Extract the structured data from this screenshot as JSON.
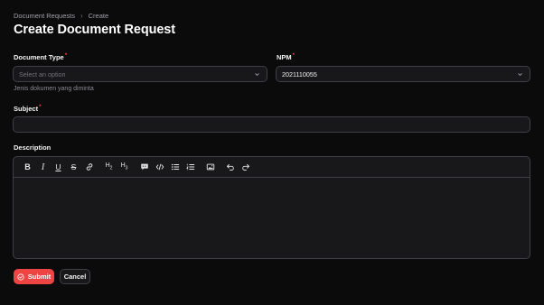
{
  "breadcrumb": {
    "parent": "Document Requests",
    "current": "Create"
  },
  "page": {
    "title": "Create Document Request"
  },
  "form": {
    "document_type": {
      "label": "Document Type",
      "required_mark": "*",
      "placeholder": "Select an option",
      "hint": "Jenis dokumen yang diminta"
    },
    "npm": {
      "label": "NPM",
      "required_mark": "*",
      "value": "2021110055"
    },
    "subject": {
      "label": "Subject",
      "required_mark": "*",
      "value": ""
    },
    "description": {
      "label": "Description",
      "toolbar": [
        {
          "name": "bold-button",
          "icon": "bold-icon",
          "glyph": "B"
        },
        {
          "name": "italic-button",
          "icon": "italic-icon",
          "glyph": "I"
        },
        {
          "name": "underline-button",
          "icon": "underline-icon",
          "glyph": "U"
        },
        {
          "name": "strikethrough-button",
          "icon": "strikethrough-icon",
          "glyph": "S"
        },
        {
          "name": "link-button",
          "icon": "link-icon"
        },
        {
          "name": "heading-2-button",
          "icon": "h2-icon",
          "glyph": "H2"
        },
        {
          "name": "heading-3-button",
          "icon": "h3-icon",
          "glyph": "H3"
        },
        {
          "name": "blockquote-button",
          "icon": "quote-icon"
        },
        {
          "name": "code-block-button",
          "icon": "code-icon"
        },
        {
          "name": "bullet-list-button",
          "icon": "bullet-list-icon"
        },
        {
          "name": "ordered-list-button",
          "icon": "ordered-list-icon"
        },
        {
          "name": "attach-image-button",
          "icon": "image-icon"
        },
        {
          "name": "undo-button",
          "icon": "undo-icon"
        },
        {
          "name": "redo-button",
          "icon": "redo-icon"
        }
      ]
    }
  },
  "actions": {
    "submit_label": "Submit",
    "cancel_label": "Cancel"
  },
  "colors": {
    "accent": "#ef4444",
    "background": "#0b0b0c",
    "field_bg": "#18181b",
    "border": "#3f3f46"
  }
}
